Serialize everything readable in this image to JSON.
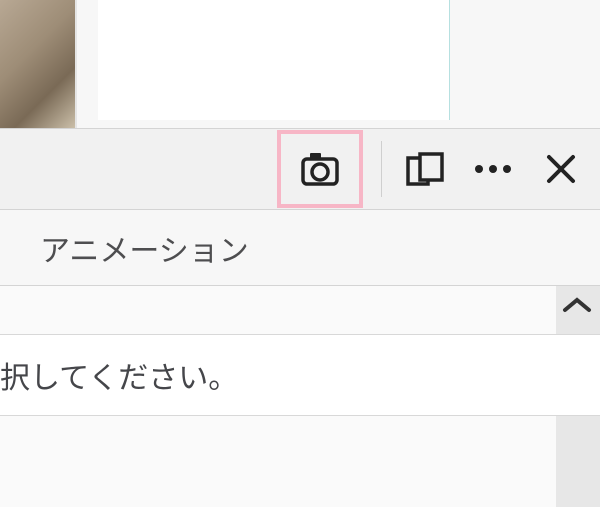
{
  "toolbar": {
    "screenshot_icon": "camera-icon",
    "toggle_icon": "device-toggle-icon",
    "more_icon": "more-icon",
    "close_icon": "close-icon"
  },
  "tabs": {
    "active_label": "アニメーション"
  },
  "message": {
    "text": "択してください。"
  }
}
